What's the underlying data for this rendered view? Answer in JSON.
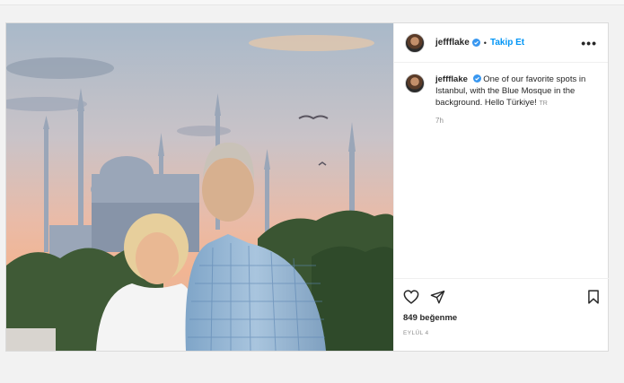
{
  "post": {
    "username": "jeffflake",
    "follow_label": "Takip Et",
    "dot": "•",
    "more_label": "•••",
    "caption_text": "One of our favorite spots in Istanbul, with the Blue Mosque in the background. Hello Türkiye!",
    "translate_label": "TR",
    "time_ago": "7h",
    "likes": "849 beğenme",
    "date": "EYLÜL 4"
  },
  "icons": {
    "verified": "verified-badge-icon",
    "like": "heart-icon",
    "share": "paper-plane-icon",
    "save": "bookmark-icon",
    "more": "more-options-icon"
  },
  "colors": {
    "accent": "#0095f6",
    "verified": "#3897f0",
    "text": "#262626",
    "muted": "#8e8e8e"
  }
}
